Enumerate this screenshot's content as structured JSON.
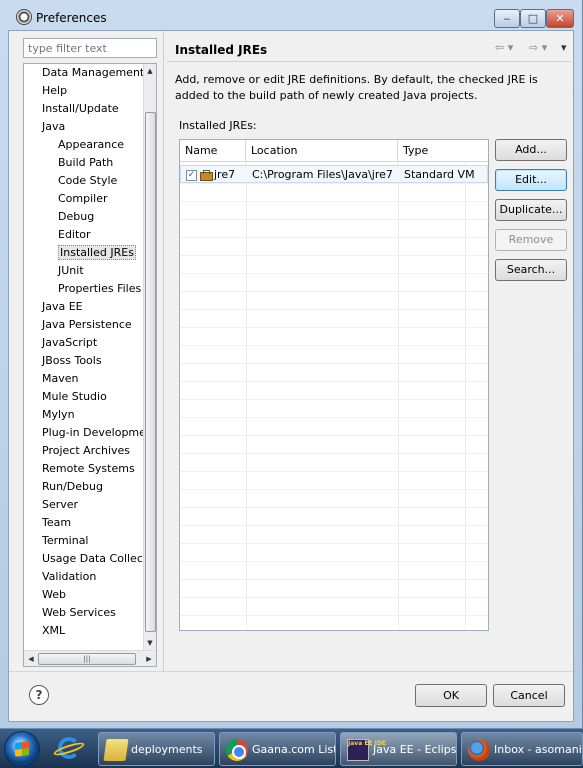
{
  "window": {
    "title": "Preferences",
    "min_glyph": "‒",
    "max_glyph": "□",
    "close_glyph": "✕"
  },
  "nav": {
    "filter_placeholder": "type filter text",
    "items": [
      {
        "label": "Data Management",
        "level": 0,
        "selected": false
      },
      {
        "label": "Help",
        "level": 0,
        "selected": false
      },
      {
        "label": "Install/Update",
        "level": 0,
        "selected": false
      },
      {
        "label": "Java",
        "level": 0,
        "selected": false
      },
      {
        "label": "Appearance",
        "level": 1,
        "selected": false
      },
      {
        "label": "Build Path",
        "level": 1,
        "selected": false
      },
      {
        "label": "Code Style",
        "level": 1,
        "selected": false
      },
      {
        "label": "Compiler",
        "level": 1,
        "selected": false
      },
      {
        "label": "Debug",
        "level": 1,
        "selected": false
      },
      {
        "label": "Editor",
        "level": 1,
        "selected": false
      },
      {
        "label": "Installed JREs",
        "level": 1,
        "selected": true
      },
      {
        "label": "JUnit",
        "level": 1,
        "selected": false
      },
      {
        "label": "Properties Files Edito",
        "level": 1,
        "selected": false
      },
      {
        "label": "Java EE",
        "level": 0,
        "selected": false
      },
      {
        "label": "Java Persistence",
        "level": 0,
        "selected": false
      },
      {
        "label": "JavaScript",
        "level": 0,
        "selected": false
      },
      {
        "label": "JBoss Tools",
        "level": 0,
        "selected": false
      },
      {
        "label": "Maven",
        "level": 0,
        "selected": false
      },
      {
        "label": "Mule Studio",
        "level": 0,
        "selected": false
      },
      {
        "label": "Mylyn",
        "level": 0,
        "selected": false
      },
      {
        "label": "Plug-in Development",
        "level": 0,
        "selected": false
      },
      {
        "label": "Project Archives",
        "level": 0,
        "selected": false
      },
      {
        "label": "Remote Systems",
        "level": 0,
        "selected": false
      },
      {
        "label": "Run/Debug",
        "level": 0,
        "selected": false
      },
      {
        "label": "Server",
        "level": 0,
        "selected": false
      },
      {
        "label": "Team",
        "level": 0,
        "selected": false
      },
      {
        "label": "Terminal",
        "level": 0,
        "selected": false
      },
      {
        "label": "Usage Data Collector",
        "level": 0,
        "selected": false
      },
      {
        "label": "Validation",
        "level": 0,
        "selected": false
      },
      {
        "label": "Web",
        "level": 0,
        "selected": false
      },
      {
        "label": "Web Services",
        "level": 0,
        "selected": false
      },
      {
        "label": "XML",
        "level": 0,
        "selected": false
      }
    ]
  },
  "page": {
    "title": "Installed JREs",
    "nav_back": "⇦ ▾",
    "nav_forward": "⇨ ▾",
    "nav_menu": "▾",
    "description": "Add, remove or edit JRE definitions. By default, the checked JRE is added to the build path of newly created Java projects.",
    "list_label": "Installed JREs:",
    "columns": {
      "name": "Name",
      "location": "Location",
      "type": "Type"
    },
    "rows": [
      {
        "checked": true,
        "check_glyph": "✓",
        "name": "jre7",
        "location": "C:\\Program Files\\Java\\jre7",
        "type": "Standard VM"
      }
    ],
    "buttons": {
      "add": "Add...",
      "edit": "Edit...",
      "duplicate": "Duplicate...",
      "remove": "Remove",
      "search": "Search..."
    }
  },
  "footer": {
    "help_glyph": "?",
    "ok": "OK",
    "cancel": "Cancel"
  },
  "taskbar": {
    "tasks": [
      {
        "label": "deployments",
        "icon": "folder-icon"
      },
      {
        "label": "Gaana.com List...",
        "icon": "chrome-icon"
      },
      {
        "label": "Java EE - Eclipse",
        "icon": "eclipse-icon",
        "active": true
      },
      {
        "label": "Inbox - asomani...",
        "icon": "firefox-icon"
      }
    ],
    "eclipse_icon_text": "Java EE IDE"
  }
}
